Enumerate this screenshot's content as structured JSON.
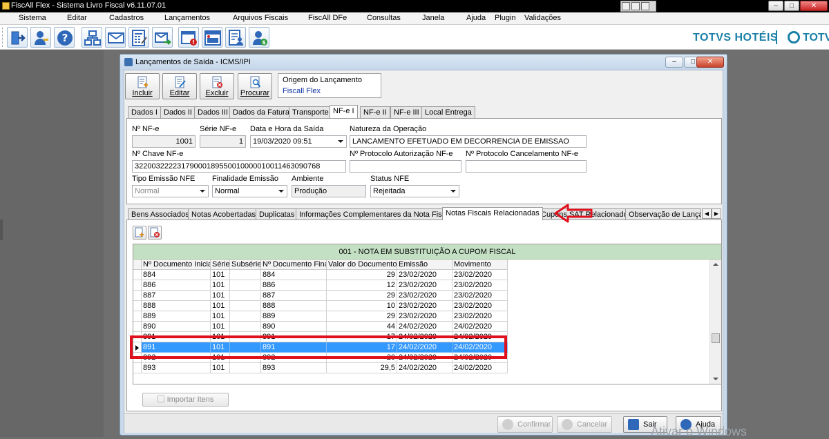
{
  "app": {
    "title": "FiscAll Flex - Sistema Livro Fiscal v6.11.07.01",
    "menu": [
      "Sistema",
      "Editar",
      "Cadastros",
      "Lançamentos",
      "Arquivos Fiscais",
      "FiscAll DFe",
      "Consultas",
      "Janela",
      "Ajuda",
      "Plugin",
      "Validações"
    ],
    "brand": "TOTVS HOTÉIS",
    "brand2": "TOTVS",
    "toolbar_icons": [
      "exit-icon",
      "user-key-icon",
      "help-icon",
      "network-icon",
      "mail-icon",
      "calculator-icon",
      "mail-send-icon",
      "calendar-alert-icon",
      "icms-icon",
      "document-user-icon",
      "user-money-icon"
    ]
  },
  "dialog": {
    "title": "Lançamentos de Saída - ICMS/IPI",
    "actions": {
      "incluir": "Incluir",
      "editar": "Editar",
      "excluir": "Excluir",
      "procurar": "Procurar"
    },
    "origem": {
      "label": "Origem do Lançamento",
      "value": "Fiscall Flex"
    },
    "tabs": [
      "Dados I",
      "Dados II",
      "Dados III",
      "Dados da Fatura",
      "Transporte",
      "NF-e I",
      "NF-e II",
      "NF-e III",
      "Local Entrega"
    ],
    "active_tab": "NF-e I",
    "form": {
      "nf_label": "Nº NF-e",
      "nf_value": "1001",
      "serie_label": "Série NF-e",
      "serie_value": "1",
      "data_label": "Data e Hora da Saída",
      "data_value": "19/03/2020 09:51",
      "natureza_label": "Natureza da Operação",
      "natureza_value": "LANCAMENTO EFETUADO EM DECORRENCIA DE EMISSAO",
      "chave_label": "Nº Chave NF-e",
      "chave_value": "32200322223179000189550010000010011463090768",
      "protocolo_aut_label": "Nº Protocolo Autorização NF-e",
      "protocolo_aut_value": "",
      "protocolo_canc_label": "Nº Protocolo Cancelamento NF-e",
      "protocolo_canc_value": "",
      "tipo_emissao_label": "Tipo Emissão NFE",
      "tipo_emissao_value": "Normal",
      "finalidade_label": "Finalidade Emissão",
      "finalidade_value": "Normal",
      "ambiente_label": "Ambiente",
      "ambiente_value": "Produção",
      "status_label": "Status NFE",
      "status_value": "Rejeitada"
    },
    "subtabs": [
      "Bens Associados",
      "Notas Acobertadas",
      "Duplicatas",
      "Informações Complementares da Nota Fiscal",
      "Notas Fiscais Relacionadas",
      "Cupons SAT Relacionados",
      "Observação de Lançam"
    ],
    "active_subtab": "Notas Fiscais Relacionadas",
    "grid": {
      "header": "001   -   NOTA EM SUBSTITUIÇÃO A CUPOM FISCAL",
      "columns": [
        "Nº Documento Inicial",
        "Série",
        "Subsérie",
        "Nº Documento Final",
        "Valor do Documento",
        "Emissão",
        "Movimento"
      ],
      "rows": [
        [
          "884",
          "101",
          "",
          "884",
          "29",
          "23/02/2020",
          "23/02/2020"
        ],
        [
          "886",
          "101",
          "",
          "886",
          "12",
          "23/02/2020",
          "23/02/2020"
        ],
        [
          "887",
          "101",
          "",
          "887",
          "29",
          "23/02/2020",
          "23/02/2020"
        ],
        [
          "888",
          "101",
          "",
          "888",
          "10",
          "23/02/2020",
          "23/02/2020"
        ],
        [
          "889",
          "101",
          "",
          "889",
          "29",
          "23/02/2020",
          "23/02/2020"
        ],
        [
          "890",
          "101",
          "",
          "890",
          "44",
          "24/02/2020",
          "24/02/2020"
        ],
        [
          "891",
          "101",
          "",
          "891",
          "17",
          "24/02/2020",
          "24/02/2020"
        ],
        [
          "891",
          "101",
          "",
          "891",
          "17",
          "24/02/2020",
          "24/02/2020"
        ],
        [
          "892",
          "101",
          "",
          "892",
          "20",
          "24/02/2020",
          "24/02/2020"
        ],
        [
          "893",
          "101",
          "",
          "893",
          "29,5",
          "24/02/2020",
          "24/02/2020"
        ]
      ],
      "selected_row": 7
    },
    "importar_label": "Importar Itens",
    "bottom": {
      "confirmar": "Confirmar",
      "cancelar": "Cancelar",
      "sair": "Sair",
      "ajuda": "Ajuda"
    }
  },
  "watermark": "Ativar o Windows",
  "colors": {
    "selection": "#3399ff",
    "grid_header": "#c4e0c4",
    "annotation_red": "#e0101c",
    "brand": "#1a7fa7"
  }
}
